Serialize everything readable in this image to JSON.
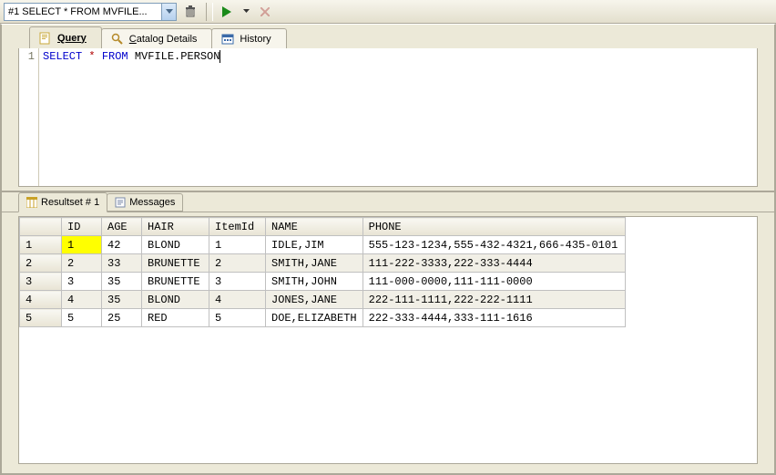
{
  "toolbar": {
    "combo_text": "#1 SELECT * FROM MVFILE..."
  },
  "upper_tabs": {
    "query": "Query",
    "catalog": "Catalog Details",
    "history": "History"
  },
  "editor": {
    "line_no": "1",
    "kw_select": "SELECT",
    "star": "*",
    "kw_from": "FROM",
    "ident": "MVFILE.PERSON"
  },
  "lower_tabs": {
    "resultset": "Resultset # 1",
    "messages": "Messages"
  },
  "grid": {
    "headers": {
      "id": "ID",
      "age": "AGE",
      "hair": "HAIR",
      "itemid": "ItemId",
      "name": "NAME",
      "phone": "PHONE"
    },
    "rows": [
      {
        "n": "1",
        "id": "1",
        "age": "42",
        "hair": "BLOND",
        "itemid": "1",
        "name": "IDLE,JIM",
        "phone": "555-123-1234,555-432-4321,666-435-0101"
      },
      {
        "n": "2",
        "id": "2",
        "age": "33",
        "hair": "BRUNETTE",
        "itemid": "2",
        "name": "SMITH,JANE",
        "phone": "111-222-3333,222-333-4444"
      },
      {
        "n": "3",
        "id": "3",
        "age": "35",
        "hair": "BRUNETTE",
        "itemid": "3",
        "name": "SMITH,JOHN",
        "phone": "111-000-0000,111-111-0000"
      },
      {
        "n": "4",
        "id": "4",
        "age": "35",
        "hair": "BLOND",
        "itemid": "4",
        "name": "JONES,JANE",
        "phone": "222-111-1111,222-222-1111"
      },
      {
        "n": "5",
        "id": "5",
        "age": "25",
        "hair": "RED",
        "itemid": "5",
        "name": "DOE,ELIZABETH",
        "phone": "222-333-4444,333-111-1616"
      }
    ]
  }
}
